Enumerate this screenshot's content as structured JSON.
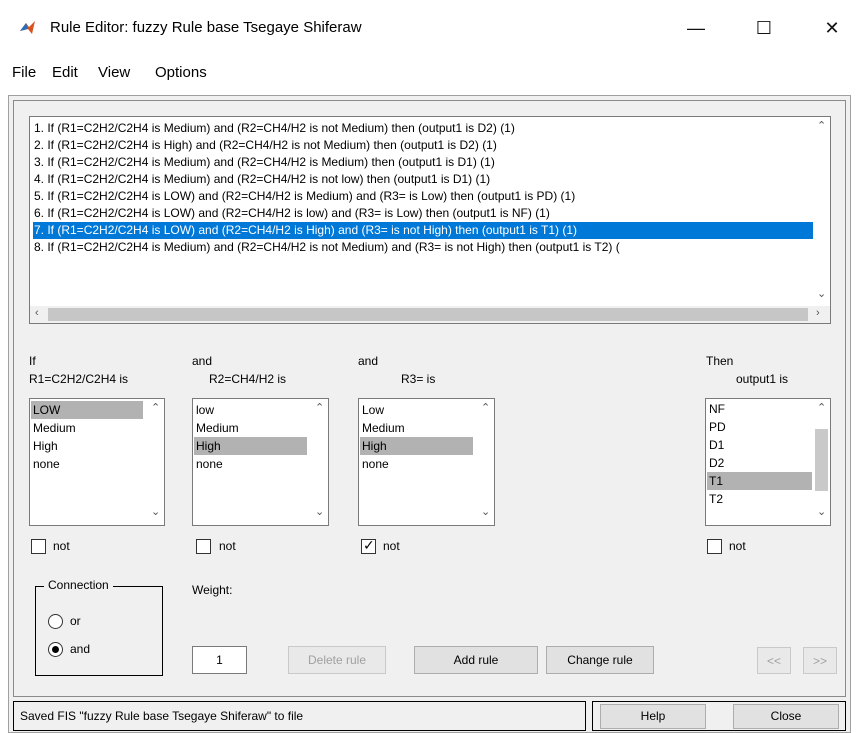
{
  "window": {
    "title": "Rule Editor: fuzzy Rule base Tsegaye Shiferaw",
    "minimize_glyph": "—",
    "maximize_glyph": "☐",
    "close_glyph": "✕"
  },
  "menu": [
    "File",
    "Edit",
    "View",
    "Options"
  ],
  "rules": [
    "1. If (R1=C2H2/C2H4 is Medium) and (R2=CH4/H2 is not Medium) then (output1 is D2) (1)",
    "2. If (R1=C2H2/C2H4 is High) and (R2=CH4/H2 is not Medium) then (output1 is D2) (1)",
    "3. If (R1=C2H2/C2H4 is Medium) and (R2=CH4/H2 is Medium) then (output1 is D1) (1)",
    "4. If (R1=C2H2/C2H4 is Medium) and (R2=CH4/H2 is not low) then (output1 is D1) (1)",
    "5. If (R1=C2H2/C2H4 is LOW) and (R2=CH4/H2 is Medium) and (R3= is Low) then (output1 is PD) (1)",
    "6. If (R1=C2H2/C2H4 is LOW) and (R2=CH4/H2 is low) and (R3= is Low) then (output1 is NF) (1)",
    "7. If (R1=C2H2/C2H4 is LOW) and (R2=CH4/H2 is High) and (R3= is not High) then (output1 is T1) (1)",
    "8. If (R1=C2H2/C2H4 is Medium) and (R2=CH4/H2 is not Medium) and (R3= is not High) then (output1 is T2) ("
  ],
  "selected_rule_index": 6,
  "inputs": {
    "if_label": "If",
    "r1_label": "R1=C2H2/C2H4 is",
    "and1_label": "and",
    "r2_label": "R2=CH4/H2 is",
    "and2_label": "and",
    "r3_label": "R3= is",
    "then_label": "Then",
    "out_label": "output1 is",
    "not_label": "not",
    "r1_options": [
      "LOW",
      "Medium",
      "High",
      "none"
    ],
    "r2_options": [
      "low",
      "Medium",
      "High",
      "none"
    ],
    "r3_options": [
      "Low",
      "Medium",
      "High",
      "none"
    ],
    "out_options": [
      "NF",
      "PD",
      "D1",
      "D2",
      "T1",
      "T2"
    ],
    "r1_selected": 0,
    "r2_selected": 2,
    "r3_selected": 2,
    "out_selected": 4,
    "r1_not": false,
    "r2_not": false,
    "r3_not": true,
    "out_not": false
  },
  "connection": {
    "title": "Connection",
    "or_label": "or",
    "and_label": "and",
    "selected": "and"
  },
  "weight": {
    "label": "Weight:",
    "value": "1"
  },
  "buttons": {
    "delete_rule": "Delete rule",
    "add_rule": "Add rule",
    "change_rule": "Change rule",
    "prev": "<<",
    "next": ">>",
    "help": "Help",
    "close": "Close"
  },
  "status": "Saved FIS \"fuzzy Rule base Tsegaye Shiferaw\" to file",
  "colors": {
    "selection": "#0078d7",
    "listbox_selection": "#b2b2b2",
    "dialog_bg": "#f0f0f0"
  }
}
